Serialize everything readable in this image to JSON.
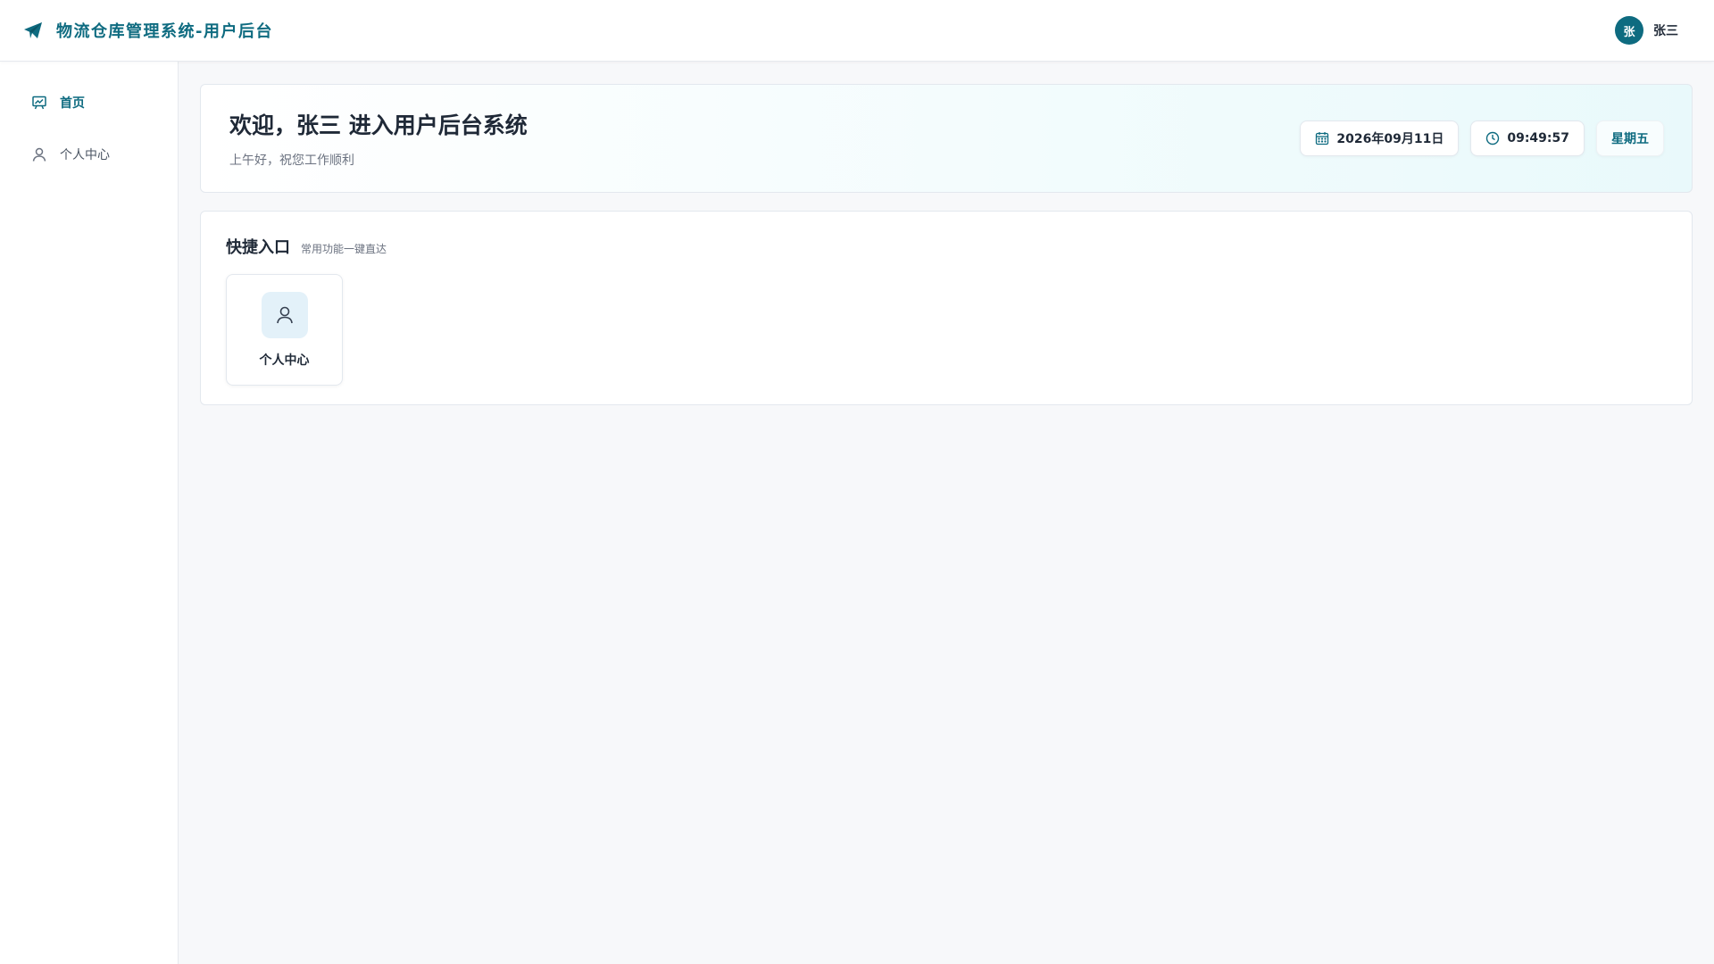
{
  "header": {
    "brand_icon": "paper-plane-icon",
    "title": "物流仓库管理系统-用户后台",
    "user": {
      "avatar_text": "张",
      "name": "张三"
    }
  },
  "sidebar": {
    "items": [
      {
        "label": "首页",
        "icon": "dashboard-icon",
        "active": true
      },
      {
        "label": "个人中心",
        "icon": "user-icon",
        "active": false
      }
    ]
  },
  "welcome": {
    "title": "欢迎，张三 进入用户后台系统",
    "subtitle": "上午好，祝您工作顺利",
    "date": "2026年09月11日",
    "time": "09:49:57",
    "weekday": "星期五"
  },
  "quick": {
    "title": "快捷入口",
    "subtitle": "常用功能一键直达",
    "items": [
      {
        "label": "个人中心",
        "icon": "user-icon"
      }
    ]
  },
  "colors": {
    "accent": "#0e6b80",
    "background": "#f7f8fa",
    "quick_icon_bg": "#e3f1f9"
  }
}
